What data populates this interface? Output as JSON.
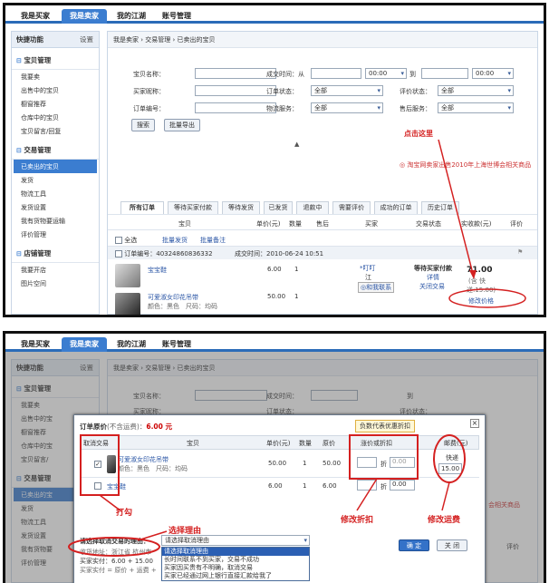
{
  "nav": {
    "tabs": [
      "我是买家",
      "我是卖家",
      "我的江湖",
      "账号管理"
    ]
  },
  "sidebar": {
    "quick": "快捷功能",
    "settings": "设置",
    "groups": [
      {
        "title": "宝贝管理",
        "items": [
          "我要卖",
          "出售中的宝贝",
          "橱窗推荐",
          "仓库中的宝贝",
          "宝贝留言/回复"
        ]
      },
      {
        "title": "交易管理",
        "items": [
          "已卖出的宝贝",
          "发货",
          "物流工具",
          "发货设置",
          "我有货物要运输",
          "评价管理"
        ]
      },
      {
        "title": "店铺管理",
        "items": [
          "我要开店",
          "图片空间"
        ]
      }
    ]
  },
  "shot2_sidebar": [
    "我要卖",
    "出售中的宝",
    "橱窗推荐",
    "仓库中的宝",
    "宝贝留言/",
    "已卖出的宝",
    "发货",
    "物流工具",
    "发货设置",
    "我有货物要",
    "评价管理"
  ],
  "breadcrumb": "我是卖家 › 交易管理 › 已卖出的宝贝",
  "filters": {
    "item_name": "宝贝名称：",
    "deal_time": "成交时间：从",
    "time_from": "00:00",
    "to": "到",
    "time_to": "00:00",
    "buyer": "买家昵称：",
    "order_status": "订单状态：",
    "order_status_val": "全部",
    "rate_status": "评价状态：",
    "rate_status_val": "全部",
    "order_no": "订单编号：",
    "logistics": "物流服务：",
    "logistics_val": "全部",
    "after_sale": "售后服务：",
    "after_sale_val": "全部",
    "search_btn": "搜索",
    "export_btn": "批量导出"
  },
  "announcement": "淘宝网卖家出售2010年上海世博会相关商品",
  "annotations": {
    "click_here": "点击这里",
    "tick": "打勾",
    "select_reason": "选择理由",
    "modify_discount": "修改折扣",
    "modify_freight": "修改运费"
  },
  "order_tabs": [
    "所有订单",
    "等待买家付款",
    "等待发货",
    "已发货",
    "退款中",
    "需要评价",
    "成功的订单",
    "历史订单"
  ],
  "table_headers": [
    "宝贝",
    "单价(元)",
    "数量",
    "售后",
    "买家",
    "交易状态",
    "实收款(元)",
    "评价"
  ],
  "bulk": {
    "select_all": "全选",
    "bulk_ship": "批量发货",
    "bulk_note": "批量备注"
  },
  "order": {
    "order_no": "订单编号：40324860836332",
    "deal_time": "成交时间：2010-06-24 10:51",
    "items": [
      {
        "name": "宝宝鞋",
        "price": "6.00",
        "qty": "1"
      },
      {
        "name": "可爱淑女印花吊带",
        "spec": "颜色：黑色　尺码：均码",
        "price": "50.00",
        "qty": "1"
      }
    ],
    "buyer": "*叮叮",
    "buyer2": "江",
    "chat": "和我联系",
    "status": "等待买家付款",
    "detail": "详情",
    "close": "关闭交易",
    "total": "71.00",
    "freight_note": "(含 快",
    "freight_note2": "递:15.00)",
    "modify_price": "修改价格"
  },
  "dialog": {
    "title": "订单原价",
    "excl": "(不含运费)：",
    "orig": "6.00 元",
    "tip": "负数代表优惠折扣",
    "headers": [
      "取消交易",
      "宝贝",
      "单价(元)",
      "数量",
      "原价",
      "涨价或折扣",
      "邮费(元)"
    ],
    "rows": [
      {
        "name": "可爱淑女印花吊带",
        "spec": "颜色：黑色　尺码：均码",
        "price": "50.00",
        "qty": "1",
        "orig": "50.00",
        "discount_label": "折",
        "discount_val": "0.00"
      },
      {
        "name": "宝宝鞋",
        "price": "6.00",
        "qty": "1",
        "orig": "6.00",
        "discount_label": "折",
        "discount_val": "0.00"
      }
    ],
    "ship_type": "快递",
    "ship_fee": "15.00",
    "reason_label": "请选择取消交易的理由：",
    "reason_default": "请选择取消理由",
    "reasons": [
      "请选择取消理由",
      "长时间联系不到买家，交易不成功",
      "买家因买贵有不明确，取消交易",
      "买家已经通过网上银行直接汇款给我了"
    ],
    "addr": "收货地址：浙江省 杭州市",
    "buyer_pay": "买家实付：6.00 + 15.00",
    "buyer_formula": "买家实付 = 原价 + 运费 +",
    "confirm": "确 定",
    "close": "关 闭"
  },
  "shot2_filters": {
    "item_name": "宝贝名称：",
    "deal_time": "成交时间：",
    "to": "到",
    "buyer": "买家昵称：",
    "order_status": "订单状态："
  },
  "shot2_side": {
    "rate": "评价",
    "rate_status": "评价状态：",
    "announcement": "会相关商品"
  }
}
